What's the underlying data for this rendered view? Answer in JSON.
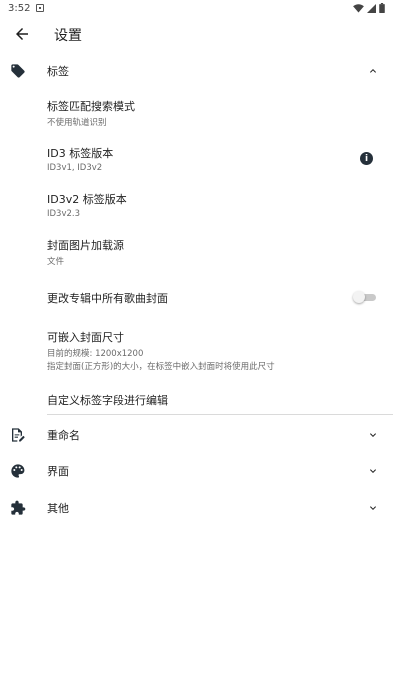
{
  "status_bar": {
    "time": "3:52"
  },
  "top_bar": {
    "title": "设置"
  },
  "sections": {
    "tags": {
      "label": "标签"
    },
    "rename": {
      "label": "重命名"
    },
    "interface": {
      "label": "界面"
    },
    "other": {
      "label": "其他"
    }
  },
  "tag_prefs": {
    "match_mode": {
      "title": "标签匹配搜索模式",
      "summary": "不使用轨道识别"
    },
    "id3_version": {
      "title": "ID3 标签版本",
      "summary": "ID3v1, ID3v2"
    },
    "id3v2_version": {
      "title": "ID3v2 标签版本",
      "summary": "ID3v2.3"
    },
    "cover_source": {
      "title": "封面图片加载源",
      "summary": "文件"
    },
    "change_album_covers": {
      "title": "更改专辑中所有歌曲封面",
      "enabled": false
    },
    "embed_cover_size": {
      "title": "可嵌入封面尺寸",
      "summary_line1": "目前的规模: 1200x1200",
      "summary_line2": "指定封面(正方形)的大小，在标签中嵌入封面时将使用此尺寸"
    },
    "custom_fields": {
      "title": "自定义标签字段进行编辑"
    }
  },
  "icons": {
    "back": "arrow-back-icon",
    "tags": "tag-icon",
    "rename": "file-edit-icon",
    "interface": "palette-icon",
    "other": "puzzle-icon",
    "expand": "chevron-down-icon",
    "collapse": "chevron-up-icon",
    "info": "info-icon"
  },
  "colors": {
    "icon": "#25303a",
    "text": "#1f1f1f",
    "subtext": "#6b6b6b"
  }
}
